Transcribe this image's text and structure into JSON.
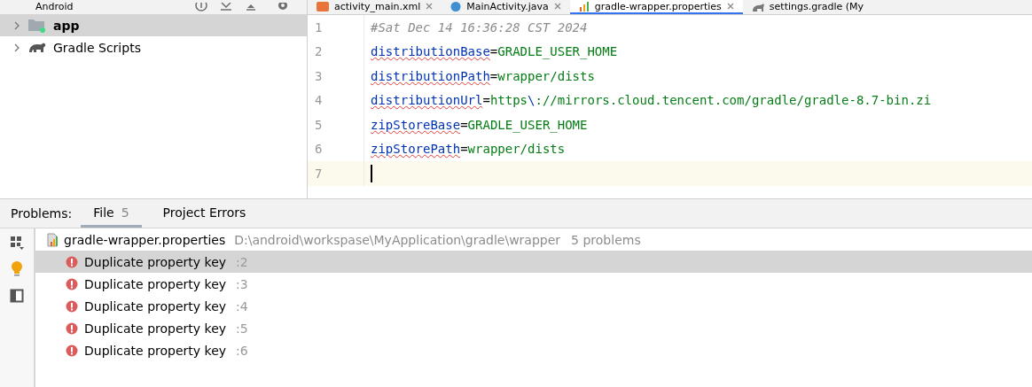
{
  "project_view": {
    "title": "Android",
    "tree": [
      {
        "label": "app",
        "kind": "module",
        "selected": true,
        "expanded": false
      },
      {
        "label": "Gradle Scripts",
        "kind": "gradle",
        "selected": false,
        "expanded": false
      }
    ]
  },
  "editor_tabs": [
    {
      "label": "activity_main.xml",
      "kind": "xml",
      "selected": false
    },
    {
      "label": "MainActivity.java",
      "kind": "java",
      "selected": false
    },
    {
      "label": "gradle-wrapper.properties",
      "kind": "properties",
      "selected": true
    },
    {
      "label": "settings.gradle (My",
      "kind": "gradle",
      "selected": false
    }
  ],
  "editor": {
    "lines": [
      {
        "number": "1",
        "current": false,
        "segments": [
          {
            "kind": "comment",
            "text": "#Sat Dec 14 16:36:28 CST 2024"
          }
        ]
      },
      {
        "number": "2",
        "current": false,
        "segments": [
          {
            "kind": "key",
            "text": "distributionBase"
          },
          {
            "kind": "op",
            "text": "="
          },
          {
            "kind": "value",
            "text": "GRADLE_USER_HOME"
          }
        ]
      },
      {
        "number": "3",
        "current": false,
        "segments": [
          {
            "kind": "key",
            "text": "distributionPath"
          },
          {
            "kind": "op",
            "text": "="
          },
          {
            "kind": "value",
            "text": "wrapper/dists"
          }
        ]
      },
      {
        "number": "4",
        "current": false,
        "segments": [
          {
            "kind": "key",
            "text": "distributionUrl"
          },
          {
            "kind": "op",
            "text": "="
          },
          {
            "kind": "value",
            "text": "https"
          },
          {
            "kind": "escape",
            "text": "\\"
          },
          {
            "kind": "value",
            "text": "://mirrors.cloud.tencent.com/gradle/gradle-8.7-bin.zi"
          }
        ]
      },
      {
        "number": "5",
        "current": false,
        "segments": [
          {
            "kind": "key",
            "text": "zipStoreBase"
          },
          {
            "kind": "op",
            "text": "="
          },
          {
            "kind": "value",
            "text": "GRADLE_USER_HOME"
          }
        ]
      },
      {
        "number": "6",
        "current": false,
        "segments": [
          {
            "kind": "key",
            "text": "zipStorePath"
          },
          {
            "kind": "op",
            "text": "="
          },
          {
            "kind": "value",
            "text": "wrapper/dists"
          }
        ]
      },
      {
        "number": "7",
        "current": true
      }
    ]
  },
  "problems": {
    "title": "Problems:",
    "tabs": [
      {
        "label": "File",
        "count": "5",
        "selected": true
      },
      {
        "label": "Project Errors",
        "selected": false
      }
    ],
    "file": {
      "name": "gradle-wrapper.properties",
      "path": "D:\\android\\workspase\\MyApplication\\gradle\\wrapper",
      "summary": "5 problems"
    },
    "items": [
      {
        "message": "Duplicate property key",
        "line": ":2",
        "selected": true
      },
      {
        "message": "Duplicate property key",
        "line": ":3",
        "selected": false
      },
      {
        "message": "Duplicate property key",
        "line": ":4",
        "selected": false
      },
      {
        "message": "Duplicate property key",
        "line": ":5",
        "selected": false
      },
      {
        "message": "Duplicate property key",
        "line": ":6",
        "selected": false
      }
    ]
  }
}
